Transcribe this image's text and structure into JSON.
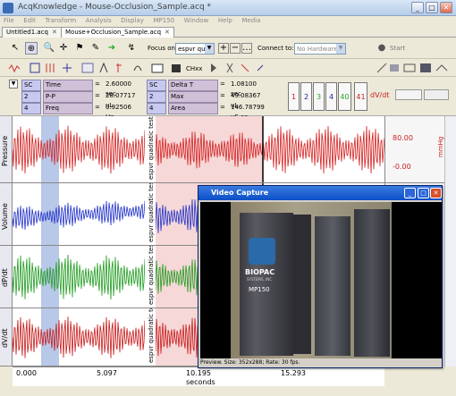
{
  "window": {
    "title": "AcqKnowledge - Mouse-Occlusion_Sample.acq *"
  },
  "menu": [
    "File",
    "Edit",
    "Transform",
    "Analysis",
    "Display",
    "MP150",
    "Window",
    "Help",
    "Media"
  ],
  "tabs": [
    {
      "label": "Untitled1.acq"
    },
    {
      "label": "Mouse+Occlusion_Sample.acq"
    }
  ],
  "toolbar": {
    "focus_label": "Focus on:",
    "focus_value": "espvr qu",
    "connect_label": "Connect to:",
    "connect_value": "No Hardware",
    "start_label": "Start"
  },
  "measurements": [
    {
      "channel": "SC",
      "type": "Time",
      "value": "2.60000 sec"
    },
    {
      "channel": "2",
      "type": "P-P",
      "value": "28.07717 uL"
    },
    {
      "channel": "4",
      "type": "Freq",
      "value": "0.92506 Hz"
    },
    {
      "channel": "SC",
      "type": "Delta T",
      "value": "1.08100 sec"
    },
    {
      "channel": "2",
      "type": "Max",
      "value": "49.08367 uL"
    },
    {
      "channel": "4",
      "type": "Area",
      "value": "146.78799 uS-se"
    }
  ],
  "measure_buttons": [
    "1",
    "2",
    "3",
    "4",
    "40",
    "41"
  ],
  "derivative_label": "dV/dt",
  "channels": [
    {
      "label": "Pressure",
      "color": "#d42020"
    },
    {
      "label": "Volume",
      "color": "#2030c8"
    },
    {
      "label": "dP/dt",
      "color": "#1c9a1c"
    },
    {
      "label": "dV/dt",
      "color": "#c81818"
    }
  ],
  "marker_text": "espvr quadratic test",
  "right_scale": {
    "top": "80.00",
    "bottom": "-0.00",
    "unit": "mmHg"
  },
  "x_axis": {
    "ticks": [
      "0.000",
      "5.097",
      "10.195",
      "15.293"
    ],
    "label": "seconds"
  },
  "video": {
    "title": "Video Capture",
    "status": "Preview. Size: 352x288; Rate: 30 fps.",
    "device_brand": "BIOPAC",
    "device_sub": "SYSTEMS, INC.",
    "device_model": "MP150"
  }
}
